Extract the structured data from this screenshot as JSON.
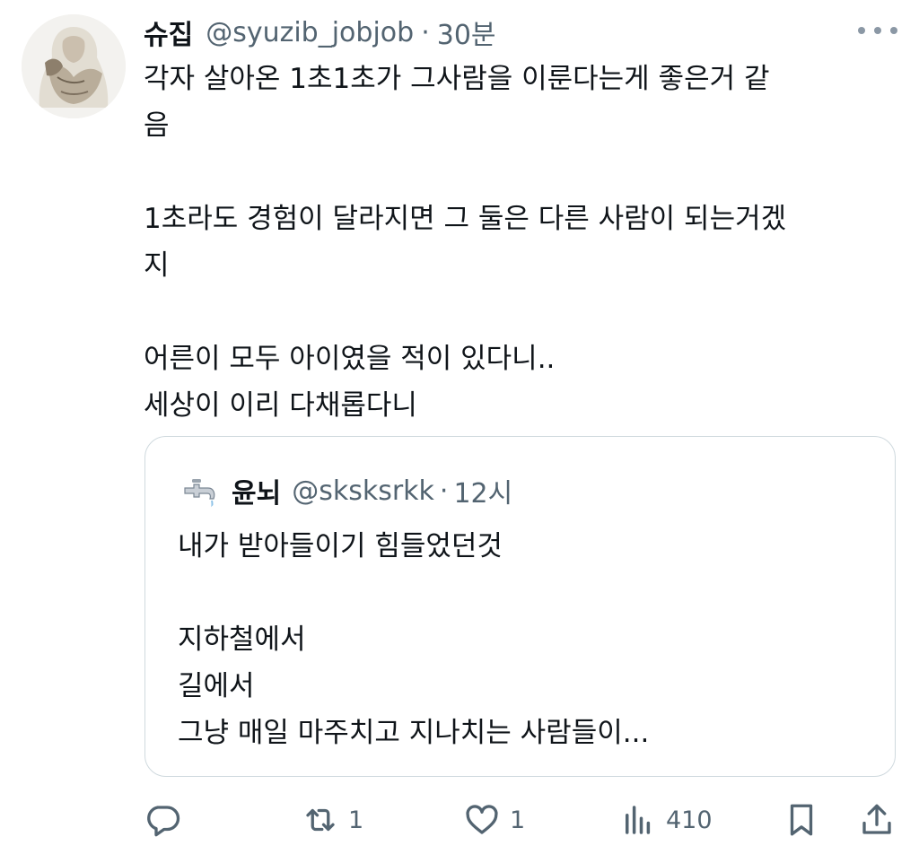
{
  "tweet": {
    "author_name": "슈집",
    "handle": "@syuzib_jobjob",
    "separator": "·",
    "time": "30분",
    "lines": [
      "각자 살아온 1초1초가 그사람을 이룬다는게 좋은거 같",
      "음",
      "",
      "1초라도 경험이 달라지면 그 둘은 다른 사람이 되는거겠",
      "지",
      "",
      "어른이 모두 아이였을 적이 있다니..",
      "세상이 이리 다채롭다니"
    ]
  },
  "quote": {
    "author_name": "윤뇌",
    "handle": "@sksksrkk",
    "separator": "·",
    "time": "12시",
    "lines": [
      "내가 받아들이기 힘들었던것",
      "",
      "지하철에서",
      "길에서",
      "그냥 매일 마주치고 지나치는 사람들이..."
    ]
  },
  "actions": {
    "reply": {
      "icon": "reply-icon",
      "count": ""
    },
    "retweet": {
      "icon": "retweet-icon",
      "count": "1"
    },
    "like": {
      "icon": "heart-icon",
      "count": "1"
    },
    "views": {
      "icon": "views-icon",
      "count": "410"
    },
    "bookmark": {
      "icon": "bookmark-icon"
    },
    "share": {
      "icon": "share-icon"
    }
  },
  "colors": {
    "text": "#0f1419",
    "secondary": "#536471",
    "border": "#cfd9de"
  }
}
